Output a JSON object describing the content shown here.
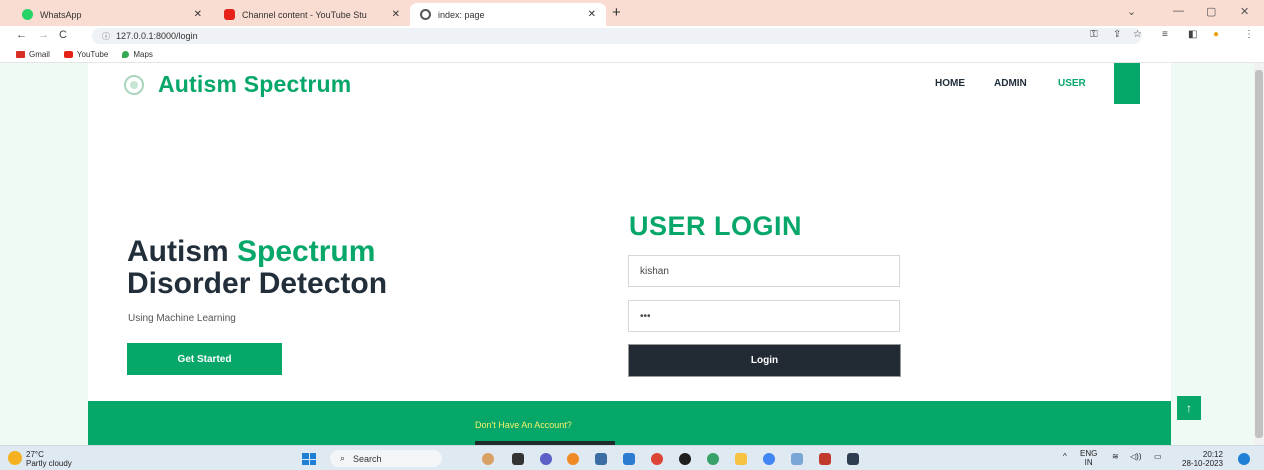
{
  "browser": {
    "tabs": [
      {
        "label": "WhatsApp",
        "active": false,
        "icon": "whatsapp-icon"
      },
      {
        "label": "Channel content - YouTube Stu",
        "active": false,
        "icon": "youtube-icon"
      },
      {
        "label": "index: page",
        "active": true,
        "icon": "globe-icon"
      }
    ],
    "address": "127.0.0.1:8000/login",
    "bookmarks": [
      {
        "label": "Gmail",
        "icon": "gmail-icon"
      },
      {
        "label": "YouTube",
        "icon": "youtube-icon"
      },
      {
        "label": "Maps",
        "icon": "maps-icon"
      }
    ]
  },
  "site": {
    "brand": "Autism Spectrum",
    "nav": [
      {
        "label": "HOME",
        "active": false
      },
      {
        "label": "ADMIN",
        "active": false
      },
      {
        "label": "USER",
        "active": true
      }
    ]
  },
  "hero": {
    "title_part1": "Autism ",
    "title_part2": "Spectrum",
    "title_line2": "Disorder Detecton",
    "subtitle": "Using Machine Learning",
    "cta_label": "Get Started"
  },
  "login": {
    "title": "USER LOGIN",
    "username_value": "kishan",
    "password_value": "•••",
    "submit_label": "Login"
  },
  "footer": {
    "text": "Don't Have An Account?"
  },
  "taskbar": {
    "temperature": "27°C",
    "weather": "Partly cloudy",
    "search_label": "Search",
    "language": "ENG",
    "region": "IN",
    "time": "20:12",
    "date": "28-10-2023"
  },
  "colors": {
    "accent": "#06a769",
    "dark": "#222b33",
    "footer_text": "#f4f06a"
  }
}
